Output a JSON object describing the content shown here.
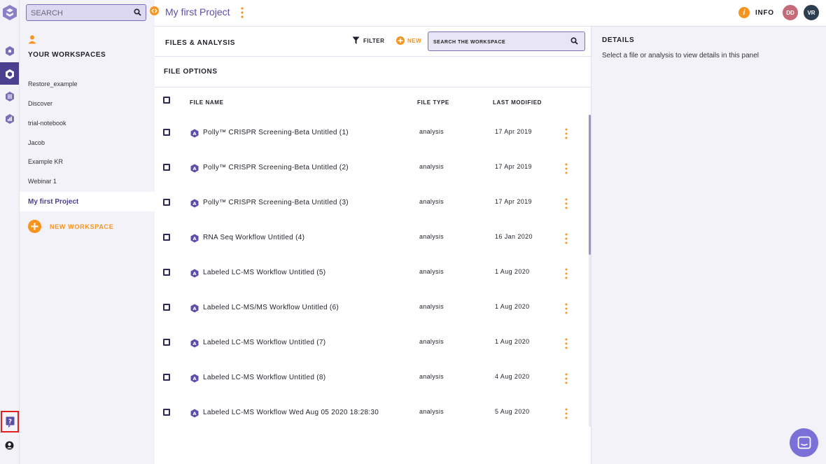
{
  "sidebar": {
    "search_placeholder": "SEARCH",
    "section_title": "YOUR WORKSPACES",
    "workspaces": [
      "Restore_example",
      "Discover",
      "trial-notebook",
      "Jacob",
      "Example KR",
      "Webinar 1"
    ],
    "active_workspace": "My first Project",
    "new_workspace_label": "NEW WORKSPACE"
  },
  "header": {
    "project_title": "My first Project",
    "info_label": "INFO",
    "avatars": [
      {
        "initials": "DD",
        "color": "#c46a78"
      },
      {
        "initials": "VR",
        "color": "#2d3e50"
      }
    ]
  },
  "files": {
    "title": "FILES & ANALYSIS",
    "filter_label": "FILTER",
    "new_label": "NEW",
    "search_placeholder": "SEARCH THE WORKSPACE",
    "options_title": "FILE OPTIONS",
    "columns": {
      "name": "FILE NAME",
      "type": "FILE TYPE",
      "modified": "LAST MODIFIED"
    },
    "rows": [
      {
        "name": "Polly™ CRISPR Screening-Beta Untitled (1)",
        "type": "analysis",
        "modified": "17 Apr 2019"
      },
      {
        "name": "Polly™ CRISPR Screening-Beta Untitled (2)",
        "type": "analysis",
        "modified": "17 Apr 2019"
      },
      {
        "name": "Polly™ CRISPR Screening-Beta Untitled (3)",
        "type": "analysis",
        "modified": "17 Apr 2019"
      },
      {
        "name": "RNA Seq Workflow Untitled (4)",
        "type": "analysis",
        "modified": "16 Jan 2020"
      },
      {
        "name": "Labeled LC-MS Workflow Untitled (5)",
        "type": "analysis",
        "modified": "1 Aug 2020"
      },
      {
        "name": "Labeled LC-MS/MS Workflow Untitled (6)",
        "type": "analysis",
        "modified": "1 Aug 2020"
      },
      {
        "name": "Labeled LC-MS Workflow Untitled (7)",
        "type": "analysis",
        "modified": "1 Aug 2020"
      },
      {
        "name": "Labeled LC-MS Workflow Untitled (8)",
        "type": "analysis",
        "modified": "4 Aug 2020"
      },
      {
        "name": "Labeled LC-MS Workflow Wed Aug 05 2020 18:28:30",
        "type": "analysis",
        "modified": "5 Aug 2020"
      }
    ]
  },
  "details": {
    "title": "DETAILS",
    "message": "Select a file or analysis to view details in this panel"
  },
  "colors": {
    "accent": "#f7941d",
    "brand": "#4b3f8f",
    "link": "#5b4fa8"
  }
}
